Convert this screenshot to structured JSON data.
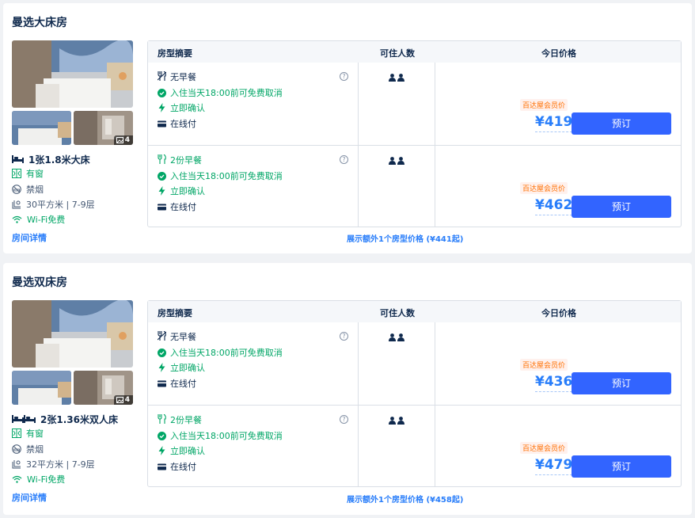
{
  "rooms": [
    {
      "title": "曼选大床房",
      "photo_count": "4",
      "bed": "1张1.8米大床",
      "window": "有窗",
      "smoking": "禁烟",
      "area": "30平方米 | 7-9层",
      "wifi": "Wi-Fi免费",
      "details_link": "房间详情",
      "table_headers": [
        "房型摘要",
        "可住人数",
        "今日价格"
      ],
      "offers": [
        {
          "meal": "无早餐",
          "cancel": "入住当天18:00前可免费取消",
          "confirm": "立即确认",
          "payment": "在线付",
          "question": "?",
          "member_badge": "百达屋会员价",
          "price": "¥419",
          "book_label": "预订"
        },
        {
          "meal": "2份早餐",
          "cancel": "入住当天18:00前可免费取消",
          "confirm": "立即确认",
          "payment": "在线付",
          "question": "?",
          "member_badge": "百达屋会员价",
          "price": "¥462",
          "book_label": "预订"
        }
      ],
      "more_prices": "展示额外1个房型价格 (¥441起)"
    },
    {
      "title": "曼选双床房",
      "photo_count": "4",
      "bed": "2张1.36米双人床",
      "window": "有窗",
      "smoking": "禁烟",
      "area": "32平方米 | 7-9层",
      "wifi": "Wi-Fi免费",
      "details_link": "房间详情",
      "table_headers": [
        "房型摘要",
        "可住人数",
        "今日价格"
      ],
      "offers": [
        {
          "meal": "无早餐",
          "cancel": "入住当天18:00前可免费取消",
          "confirm": "立即确认",
          "payment": "在线付",
          "question": "?",
          "member_badge": "百达屋会员价",
          "price": "¥436",
          "book_label": "预订"
        },
        {
          "meal": "2份早餐",
          "cancel": "入住当天18:00前可免费取消",
          "confirm": "立即确认",
          "payment": "在线付",
          "question": "?",
          "member_badge": "百达屋会员价",
          "price": "¥479",
          "book_label": "预订"
        }
      ],
      "more_prices": "展示额外1个房型价格 (¥458起)"
    }
  ],
  "icons": {
    "bed": "bed-icon",
    "window": "window-icon",
    "smoking": "no-smoking-icon",
    "area": "area-icon",
    "wifi": "wifi-icon",
    "meal_none": "no-meal-icon",
    "meal": "meal-icon",
    "cancel": "check-circle-icon",
    "confirm": "lightning-icon",
    "payment": "card-icon",
    "guests": "person-icon",
    "photos": "image-icon"
  },
  "colors": {
    "accent": "#287dfa",
    "button": "#3264ff",
    "green": "#00a666",
    "badge_text": "#ff6f00",
    "badge_bg": "#fff1ed"
  }
}
